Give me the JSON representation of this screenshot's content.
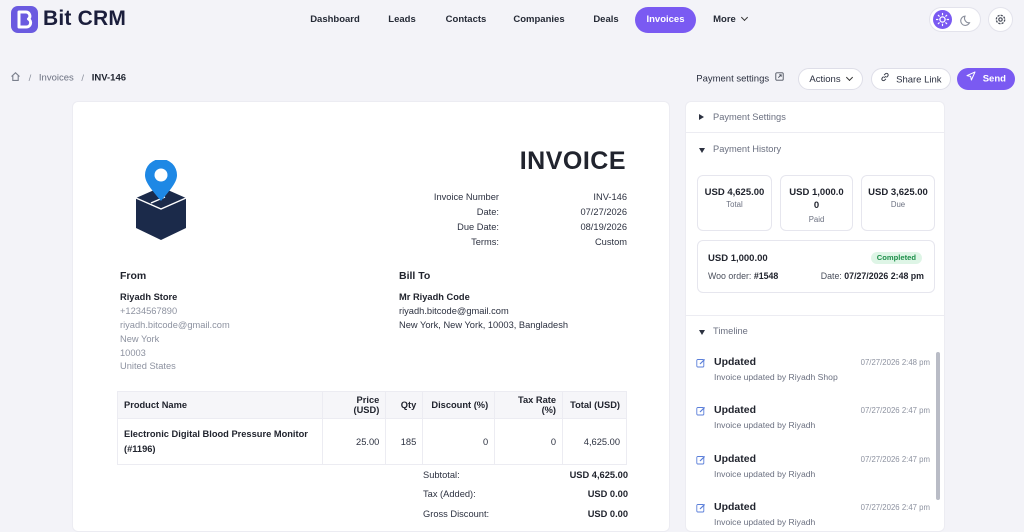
{
  "app": {
    "name": "Bit CRM"
  },
  "nav": {
    "items": [
      {
        "label": "Dashboard"
      },
      {
        "label": "Leads"
      },
      {
        "label": "Contacts"
      },
      {
        "label": "Companies"
      },
      {
        "label": "Deals"
      },
      {
        "label": "Invoices",
        "active": true
      },
      {
        "label": "More"
      }
    ]
  },
  "breadcrumb": {
    "parent": "Invoices",
    "current": "INV-146"
  },
  "actions": {
    "payment_settings": "Payment settings",
    "actions": "Actions",
    "share_link": "Share Link",
    "send": "Send"
  },
  "invoice": {
    "title": "INVOICE",
    "meta": [
      {
        "label": "Invoice Number",
        "value": "INV-146"
      },
      {
        "label": "Date:",
        "value": "07/27/2026"
      },
      {
        "label": "Due Date:",
        "value": "08/19/2026"
      },
      {
        "label": "Terms:",
        "value": "Custom"
      }
    ],
    "from": {
      "heading": "From",
      "name": "Riyadh Store",
      "phone": "+1234567890",
      "email": "riyadh.bitcode@gmail.com",
      "city": "New York",
      "zip": "10003",
      "country": "United States"
    },
    "bill_to": {
      "heading": "Bill To",
      "name": "Mr Riyadh Code",
      "email": "riyadh.bitcode@gmail.com",
      "address": "New York, New York, 10003, Bangladesh"
    },
    "table": {
      "headers": [
        "Product Name",
        "Price (USD)",
        "Qty",
        "Discount (%)",
        "Tax Rate (%)",
        "Total (USD)"
      ],
      "rows": [
        {
          "product_line1": "Electronic Digital Blood Pressure Monitor",
          "product_line2": "(#1196)",
          "price": "25.00",
          "qty": "185",
          "discount": "0",
          "tax": "0",
          "total": "4,625.00"
        }
      ]
    },
    "totals": [
      {
        "label": "Subtotal:",
        "value": "USD 4,625.00"
      },
      {
        "label": "Tax (Added):",
        "value": "USD 0.00"
      },
      {
        "label": "Gross Discount:",
        "value": "USD 0.00"
      }
    ]
  },
  "panel": {
    "payment_settings_label": "Payment Settings",
    "payment_history_label": "Payment History",
    "summary": [
      {
        "amount": "USD 4,625.00",
        "label": "Total"
      },
      {
        "amount": "USD 1,000.0",
        "amount2": "0",
        "label": "Paid"
      },
      {
        "amount": "USD 3,625.00",
        "label": "Due"
      }
    ],
    "payment": {
      "amount": "USD 1,000.00",
      "status": "Completed",
      "order_label": "Woo order:",
      "order_value": "#1548",
      "date_label": "Date:",
      "date_value": "07/27/2026 2:48 pm"
    },
    "timeline_label": "Timeline",
    "timeline": [
      {
        "title": "Updated",
        "date": "07/27/2026 2:48 pm",
        "desc": "Invoice updated by Riyadh Shop"
      },
      {
        "title": "Updated",
        "date": "07/27/2026 2:47 pm",
        "desc": "Invoice updated by Riyadh"
      },
      {
        "title": "Updated",
        "date": "07/27/2026 2:47 pm",
        "desc": "Invoice updated by Riyadh"
      },
      {
        "title": "Updated",
        "date": "07/27/2026 2:47 pm",
        "desc": "Invoice updated by Riyadh"
      }
    ]
  },
  "colors": {
    "accent": "#7a5af2",
    "logo_blue": "#1e88e5",
    "logo_navy": "#1b2a4a",
    "success_bg": "#def5e6",
    "success_text": "#1e8f4a"
  },
  "icons": [
    "bitcrm-logo-icon",
    "home-icon",
    "external-link-icon",
    "chevron-down-icon",
    "link-icon",
    "send-icon",
    "sun-icon",
    "moon-icon",
    "gear-icon",
    "edit-icon",
    "location-box-logo"
  ]
}
